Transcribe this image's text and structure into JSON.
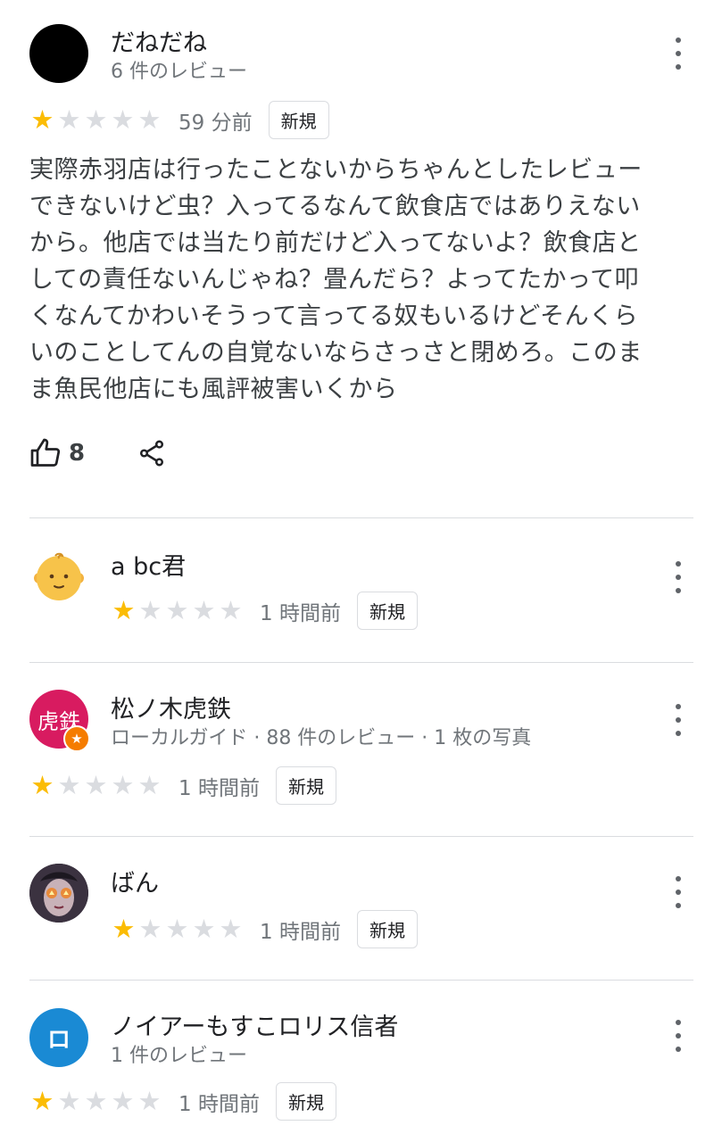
{
  "reviews": [
    {
      "name": "だねだね",
      "meta": "6 件のレビュー",
      "rating": 1,
      "time": "59 分前",
      "badge": "新規",
      "text": "実際赤羽店は行ったことないからちゃんとしたレビューできないけど虫？入ってるなんて飲食店ではありえないから。他店では当たり前だけど入ってないよ？飲食店としての責任ないんじゃね？畳んだら？よってたかって叩くなんてかわいそうって言ってる奴もいるけどそんくらいのことしてんの自覚ないならさっさと閉めろ。このまま魚民他店にも風評被害いくから",
      "likes": "8",
      "avatar": "black-circle"
    },
    {
      "name": "a bc君",
      "rating": 1,
      "time": "1 時間前",
      "badge": "新規",
      "avatar": "baby-emoji"
    },
    {
      "name": "松ノ木虎鉄",
      "meta": "ローカルガイド · 88 件のレビュー · 1 枚の写真",
      "rating": 1,
      "time": "1 時間前",
      "badge": "新規",
      "avatar_text": "虎鉄",
      "avatar_color": "#d81b60"
    },
    {
      "name": "ばん",
      "rating": 1,
      "time": "1 時間前",
      "badge": "新規",
      "avatar": "photo-face"
    },
    {
      "name": "ノイアーもすこロリス信者",
      "meta": "1 件のレビュー",
      "rating": 1,
      "time": "1 時間前",
      "badge": "新規",
      "avatar_text": "ロ",
      "avatar_color": "#1a8ad4"
    }
  ],
  "star_char": "★",
  "guide_star": "★",
  "colors": {
    "star_on": "#fbbc04",
    "star_off": "#dadce0"
  }
}
